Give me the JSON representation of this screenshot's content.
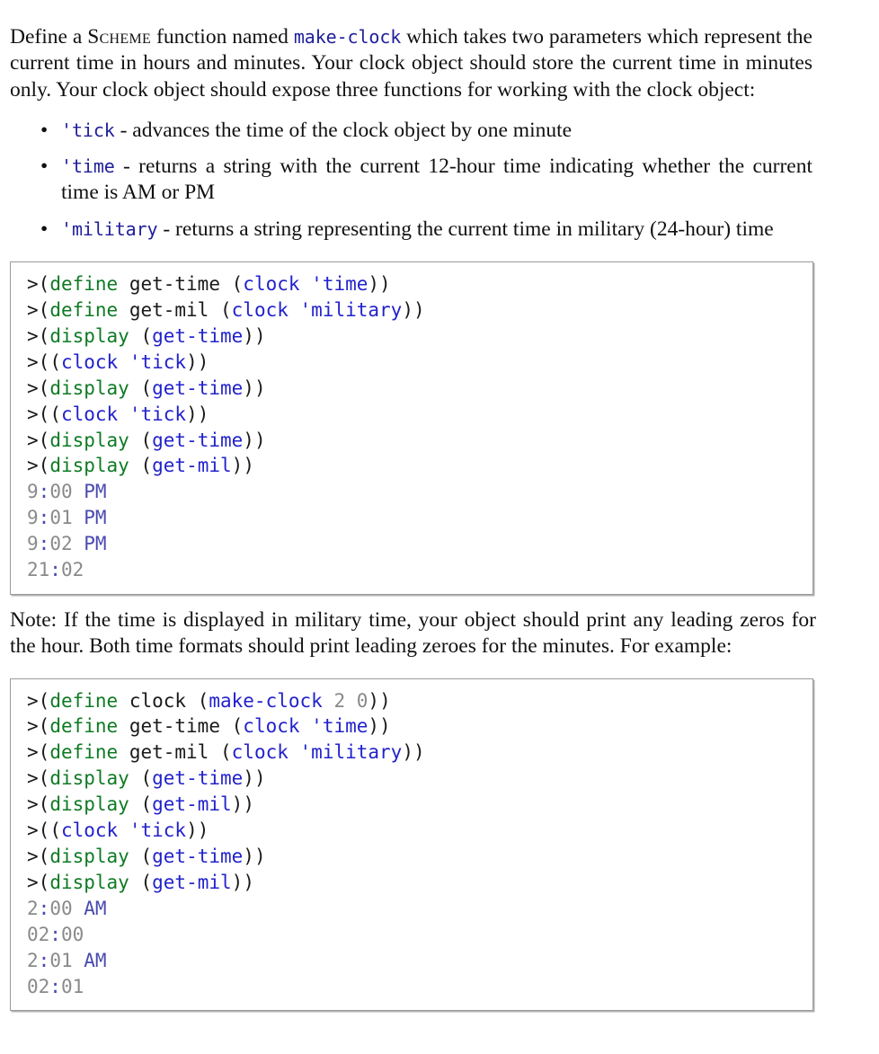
{
  "intro": {
    "before_scheme": "Define a ",
    "scheme_word": "Scheme",
    "after_scheme": " function named ",
    "code_name": "make-clock",
    "rest": " which takes two parameters which represent the current time in hours and minutes. Your clock object should store the current time in minutes only. Your clock object should expose three functions for working with the clock object:"
  },
  "bullets": [
    {
      "marker": "•",
      "code": "'tick",
      "text": " - advances the time of the clock object by one minute"
    },
    {
      "marker": "•",
      "code": "'time",
      "text": " - returns a string with the current 12-hour time indicating whether the current time is AM or PM"
    },
    {
      "marker": "•",
      "code": "'military",
      "text": " - returns a string representing the current time in military (24-hour) time"
    }
  ],
  "code_block_1": {
    "lines": [
      ">(define get-time (clock 'time))",
      ">(define get-mil (clock 'military))",
      ">(display (get-time))",
      ">((clock 'tick))",
      ">(display (get-time))",
      ">((clock 'tick))",
      ">(display (get-time))",
      ">(display (get-mil))",
      "9:00 PM",
      "9:01 PM",
      "9:02 PM",
      "21:02"
    ]
  },
  "note": {
    "text": "Note: If the time is displayed in military time, your object should print any leading zeros for the hour. Both time formats should print leading zeroes for the minutes. For example:"
  },
  "code_block_2": {
    "lines": [
      ">(define clock (make-clock 2 0))",
      ">(define get-time (clock 'time))",
      ">(define get-mil (clock 'military))",
      ">(display (get-time))",
      ">(display (get-mil))",
      ">((clock 'tick))",
      ">(display (get-time))",
      ">(display (get-mil))",
      "2:00 AM",
      "02:00",
      "2:01 AM",
      "02:01"
    ]
  },
  "colors": {
    "keyword_green": "#0f7a24",
    "variable_blue": "#2222cc",
    "output_gray": "#8a8a8a",
    "body_text": "#111111",
    "code_border": "#9a9a9a",
    "inline_code_blue": "#20209a"
  }
}
